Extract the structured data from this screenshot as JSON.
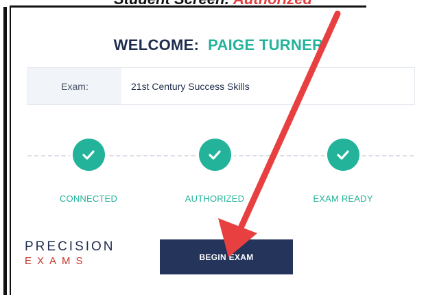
{
  "caption": {
    "prefix": "Student Screen: ",
    "emphasis": "Authorized"
  },
  "welcome": {
    "label": "WELCOME:",
    "name": "PAIGE TURNER"
  },
  "exam": {
    "label": "Exam:",
    "value": "21st Century Success Skills"
  },
  "steps": [
    {
      "label": "CONNECTED",
      "icon": "check-icon"
    },
    {
      "label": "AUTHORIZED",
      "icon": "check-icon"
    },
    {
      "label": "EXAM READY",
      "icon": "check-icon"
    }
  ],
  "logo": {
    "top": "PRECISION",
    "bottom": "EXAMS"
  },
  "begin_button": {
    "label": "BEGIN EXAM"
  },
  "colors": {
    "accent": "#22b39a",
    "navy": "#24345a",
    "arrow": "#e84040"
  }
}
